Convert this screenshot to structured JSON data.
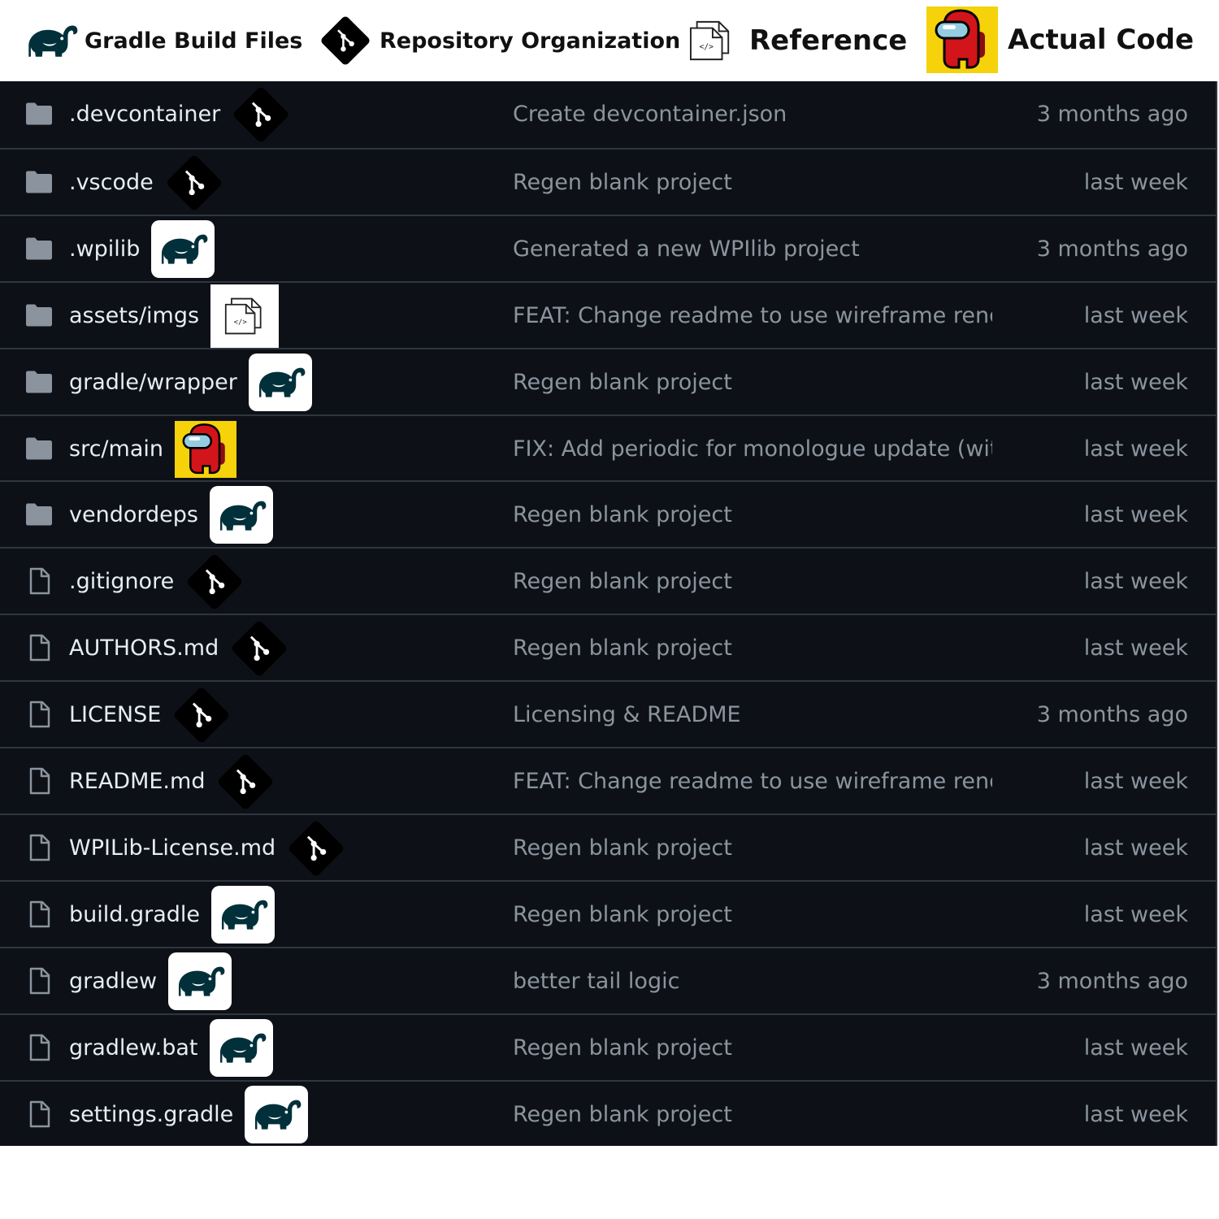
{
  "legend": {
    "gradle_label": "Gradle Build Files",
    "repo_label": "Repository Organization",
    "reference_label": "Reference",
    "code_label": "Actual Code"
  },
  "colors": {
    "table_bg": "#0d1117",
    "row_border": "#30363d",
    "file_name": "#e6edf3",
    "muted_text": "#8b949e",
    "folder_icon": "#8b949e",
    "gradle_elephant": "#02303a",
    "git_diamond": "#000000",
    "code_badge_bg": "#f5d20a",
    "crewmate_red": "#d2141b"
  },
  "files": [
    {
      "name": ".devcontainer",
      "type": "folder",
      "category": "repo",
      "message": "Create devcontainer.json",
      "date": "3 months ago"
    },
    {
      "name": ".vscode",
      "type": "folder",
      "category": "repo",
      "message": "Regen blank project",
      "date": "last week"
    },
    {
      "name": ".wpilib",
      "type": "folder",
      "category": "gradle",
      "message": "Generated a new WPIlib project",
      "date": "3 months ago"
    },
    {
      "name": "assets/imgs",
      "type": "folder",
      "category": "reference",
      "message": "FEAT: Change readme to use wireframe render",
      "date": "last week"
    },
    {
      "name": "gradle/wrapper",
      "type": "folder",
      "category": "gradle",
      "message": "Regen blank project",
      "date": "last week"
    },
    {
      "name": "src/main",
      "type": "folder",
      "category": "code",
      "message": "FIX: Add periodic for monologue update (wit...",
      "date": "last week"
    },
    {
      "name": "vendordeps",
      "type": "folder",
      "category": "gradle",
      "message": "Regen blank project",
      "date": "last week"
    },
    {
      "name": ".gitignore",
      "type": "file",
      "category": "repo",
      "message": "Regen blank project",
      "date": "last week"
    },
    {
      "name": "AUTHORS.md",
      "type": "file",
      "category": "repo",
      "message": "Regen blank project",
      "date": "last week"
    },
    {
      "name": "LICENSE",
      "type": "file",
      "category": "repo",
      "message": "Licensing & README",
      "date": "3 months ago"
    },
    {
      "name": "README.md",
      "type": "file",
      "category": "repo",
      "message": "FEAT: Change readme to use wireframe render",
      "date": "last week"
    },
    {
      "name": "WPILib-License.md",
      "type": "file",
      "category": "repo",
      "message": "Regen blank project",
      "date": "last week"
    },
    {
      "name": "build.gradle",
      "type": "file",
      "category": "gradle",
      "message": "Regen blank project",
      "date": "last week"
    },
    {
      "name": "gradlew",
      "type": "file",
      "category": "gradle",
      "message": "better tail logic",
      "date": "3 months ago"
    },
    {
      "name": "gradlew.bat",
      "type": "file",
      "category": "gradle",
      "message": "Regen blank project",
      "date": "last week"
    },
    {
      "name": "settings.gradle",
      "type": "file",
      "category": "gradle",
      "message": "Regen blank project",
      "date": "last week"
    }
  ]
}
